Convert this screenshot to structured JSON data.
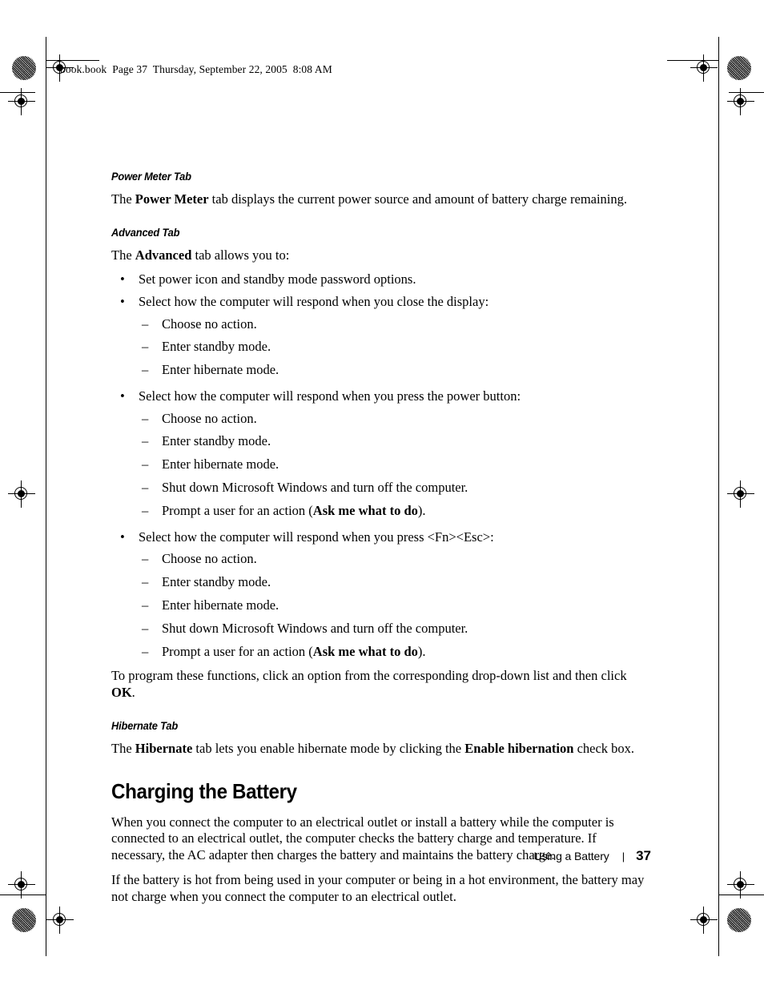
{
  "header": {
    "text": "book.book  Page 37  Thursday, September 22, 2005  8:08 AM"
  },
  "sections": {
    "power_meter": {
      "heading": "Power Meter Tab",
      "para_pre": "The ",
      "para_bold": "Power Meter",
      "para_post": " tab displays the current power source and amount of battery charge remaining."
    },
    "advanced": {
      "heading": "Advanced Tab",
      "intro_pre": "The ",
      "intro_bold": "Advanced",
      "intro_post": " tab allows you to:",
      "bullet1": "Set power icon and standby mode password options.",
      "bullet2": "Select how the computer will respond when you close the display:",
      "bullet2_sub": [
        "Choose no action.",
        "Enter standby mode.",
        "Enter hibernate mode."
      ],
      "bullet3": "Select how the computer will respond when you press the power button:",
      "bullet3_sub": [
        "Choose no action.",
        "Enter standby mode.",
        "Enter hibernate mode.",
        "Shut down Microsoft Windows and turn off the computer."
      ],
      "bullet3_sub_last_pre": "Prompt a user for an action (",
      "bullet3_sub_last_bold": "Ask me what to do",
      "bullet3_sub_last_post": ").",
      "bullet4": "Select how the computer will respond when you press <Fn><Esc>:",
      "bullet4_sub": [
        "Choose no action.",
        "Enter standby mode.",
        "Enter hibernate mode.",
        "Shut down Microsoft Windows and turn off the computer."
      ],
      "bullet4_sub_last_pre": "Prompt a user for an action (",
      "bullet4_sub_last_bold": "Ask me what to do",
      "bullet4_sub_last_post": ").",
      "closing_pre": "To program these functions, click an option from the corresponding drop-down list and then click ",
      "closing_bold": "OK",
      "closing_post": "."
    },
    "hibernate": {
      "heading": "Hibernate Tab",
      "para_pre": "The ",
      "para_bold1": "Hibernate",
      "para_mid": " tab lets you enable hibernate mode by clicking the ",
      "para_bold2": "Enable hibernation",
      "para_post": " check box."
    },
    "charging": {
      "heading": "Charging the Battery",
      "para1": "When you connect the computer to an electrical outlet or install a battery while the computer is connected to an electrical outlet, the computer checks the battery charge and temperature. If necessary, the AC adapter then charges the battery and maintains the battery charge.",
      "para2": "If the battery is hot from being used in your computer or being in a hot environment, the battery may not charge when you connect the computer to an electrical outlet."
    }
  },
  "footer": {
    "label": "Using a Battery",
    "separator": "|",
    "page_number": "37"
  },
  "markers": {
    "bullet_glyph": "•",
    "dash_glyph": "–"
  },
  "colors": {
    "text": "#000000",
    "background": "#ffffff",
    "mark": "#000000"
  }
}
